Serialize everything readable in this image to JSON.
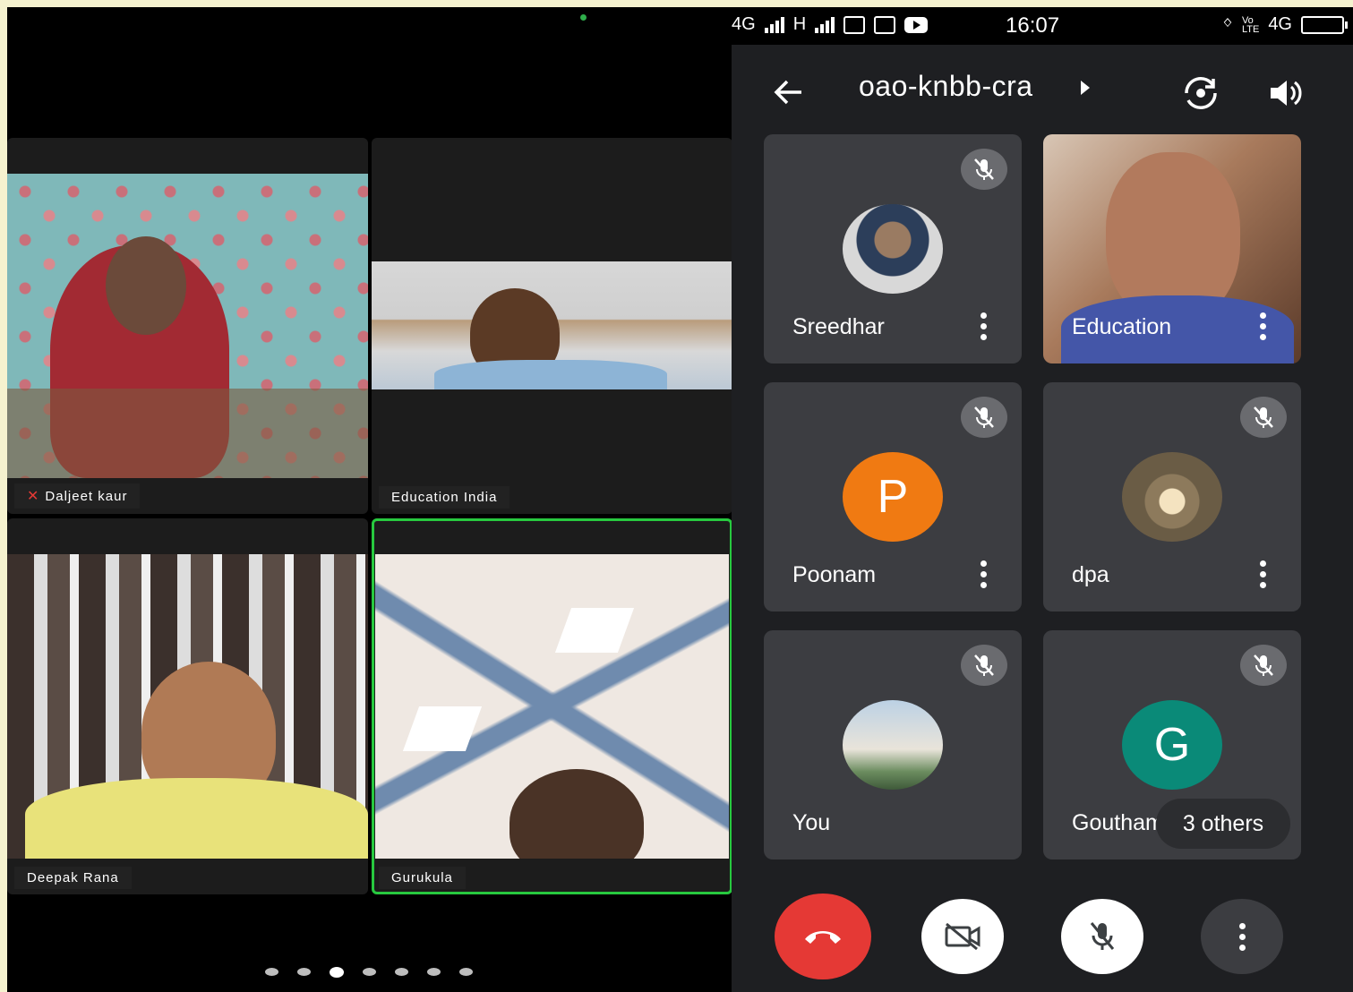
{
  "left_gallery": {
    "participants": [
      {
        "name": "Daljeet kaur",
        "muted": true
      },
      {
        "name": "Education India",
        "muted": false
      },
      {
        "name": "Deepak Rana",
        "muted": false
      },
      {
        "name": "Gurukula",
        "muted": false,
        "active_speaker": true
      }
    ],
    "pages": 7,
    "current_page": 3
  },
  "status_bar": {
    "network_left": "4G",
    "network_h": "H",
    "time": "16:07",
    "network_right": "4G"
  },
  "meet": {
    "meeting_code": "oao-knbb-cra",
    "participants": [
      {
        "name": "Sreedhar",
        "avatar": "photo",
        "muted": true
      },
      {
        "name": "Education",
        "avatar": "video",
        "muted": false
      },
      {
        "name": "Poonam",
        "avatar_letter": "P",
        "avatar_color": "#f07a12",
        "muted": true
      },
      {
        "name": "dpa",
        "avatar": "photo",
        "muted": true
      },
      {
        "name": "You",
        "avatar": "photo",
        "muted": true
      },
      {
        "name": "Goutham",
        "avatar_letter": "G",
        "avatar_color": "#0a8a78",
        "muted": true
      }
    ],
    "others_label": "3 others",
    "end_call_color": "#e53935"
  }
}
